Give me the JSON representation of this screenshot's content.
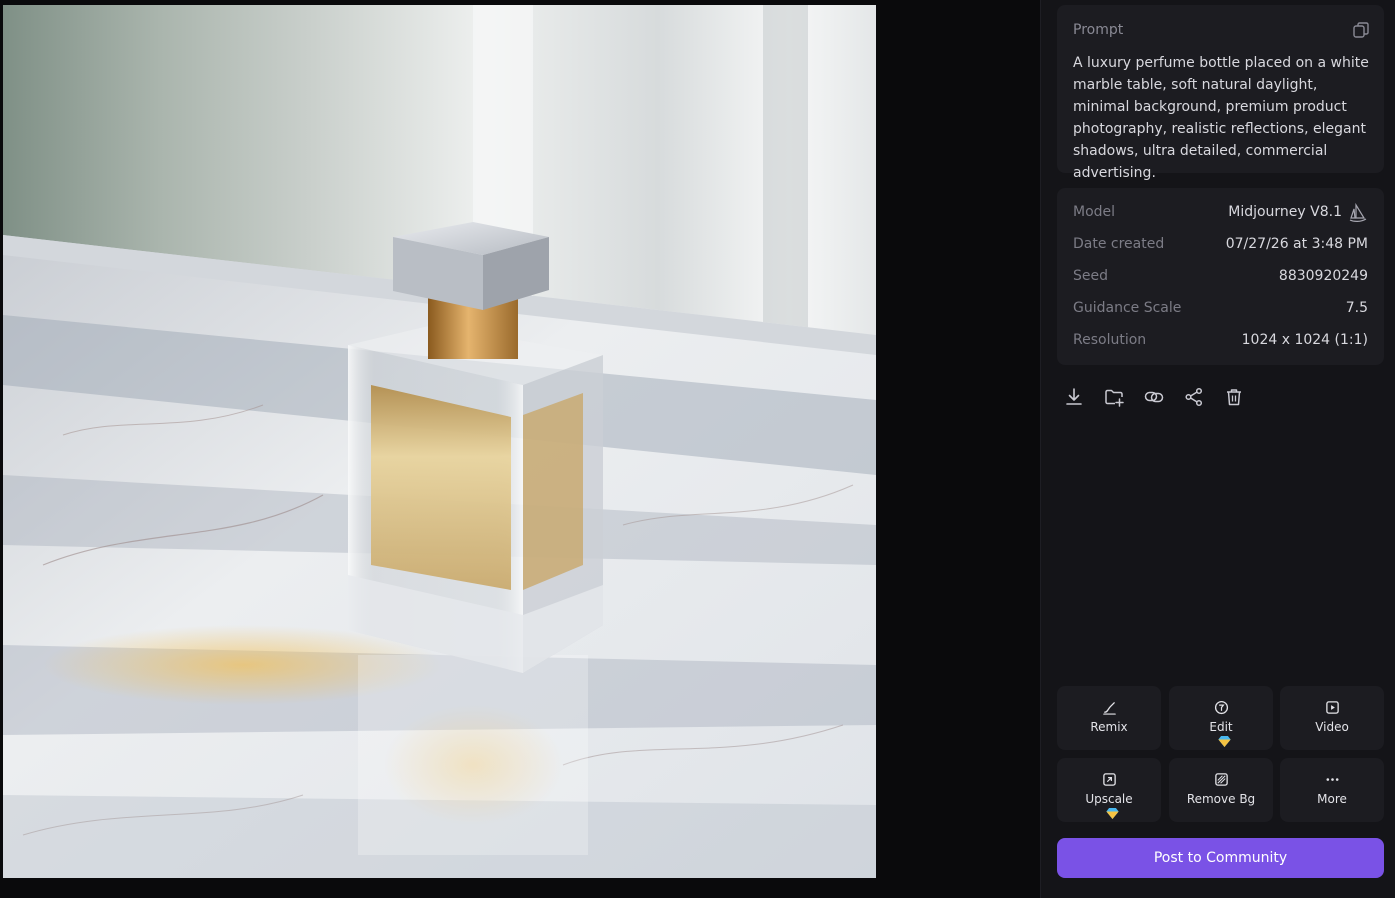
{
  "prompt": {
    "label": "Prompt",
    "text": "A luxury perfume bottle placed on a white marble table, soft natural daylight, minimal background, premium product photography, realistic reflections, elegant shadows, ultra detailed, commercial advertising."
  },
  "details": {
    "model_label": "Model",
    "model_value": "Midjourney V8.1",
    "date_label": "Date created",
    "date_value": "07/27/26 at 3:48 PM",
    "seed_label": "Seed",
    "seed_value": "8830920249",
    "guidance_label": "Guidance Scale",
    "guidance_value": "7.5",
    "resolution_label": "Resolution",
    "resolution_value": "1024 x 1024 (1:1)"
  },
  "toolbar_icons": [
    "download-icon",
    "folder-add-icon",
    "link-icon",
    "share-icon",
    "trash-icon"
  ],
  "actions": {
    "remix": "Remix",
    "edit": "Edit",
    "video": "Video",
    "upscale": "Upscale",
    "remove_bg": "Remove Bg",
    "more": "More"
  },
  "post_button": "Post to Community",
  "colors": {
    "accent": "#7a52e6",
    "panel": "#141418",
    "card": "#1c1c21"
  }
}
